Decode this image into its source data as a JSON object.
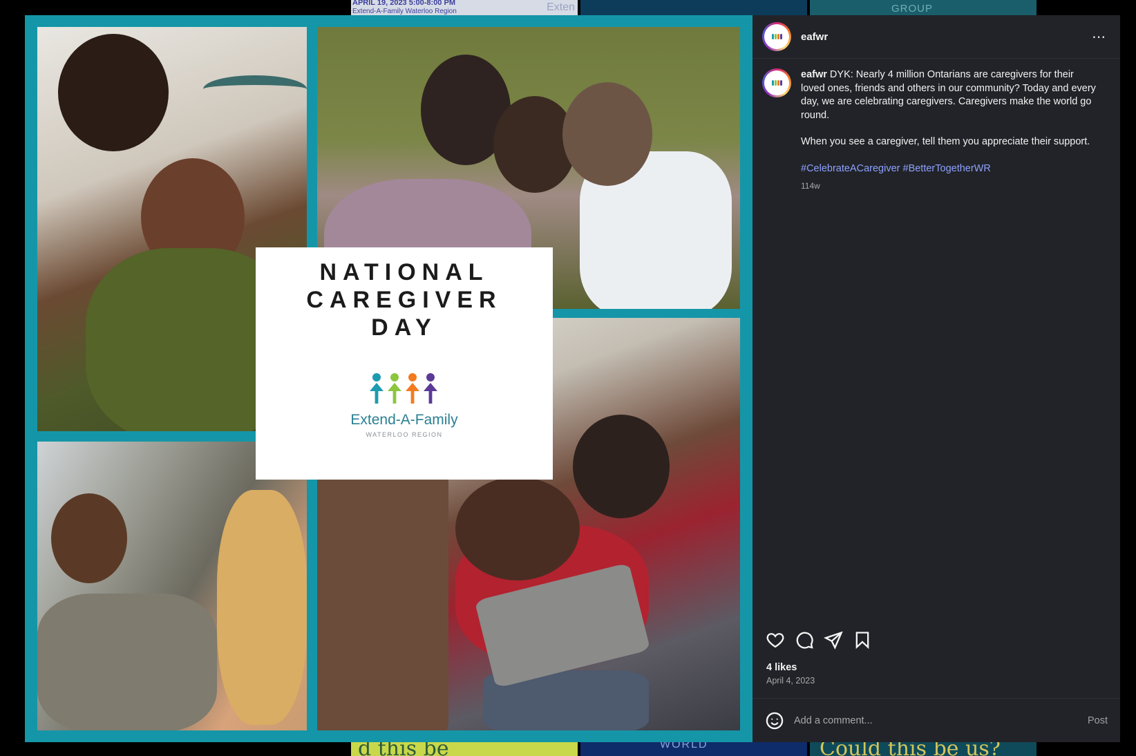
{
  "background_feed": {
    "top_left_line1": "APRIL 19, 2023    5:00-8:00 PM",
    "top_left_line2": "Extend-A-Family Waterloo Region",
    "top_left_side": "Exten",
    "top_right_word": "GROUP",
    "bottom_left_word": "d this be",
    "bottom_mid_word": "WORLD",
    "bottom_right_word": "Could this be us?"
  },
  "post_image": {
    "title_lines": [
      "NATIONAL",
      "CAREGIVER",
      "DAY"
    ],
    "logo_name": "Extend-A-Family",
    "logo_sub": "WATERLOO REGION",
    "logo_colors": [
      "#1d9bb0",
      "#8cc63f",
      "#f47a20",
      "#5b3a97"
    ],
    "frame_color": "#1596a8"
  },
  "header": {
    "username": "eafwr",
    "more_icon": "more-horizontal-icon"
  },
  "caption": {
    "username": "eafwr",
    "text": "DYK: Nearly 4 million Ontarians are caregivers for their loved ones, friends and others in our community? Today and every day, we are celebrating caregivers. Caregivers make the world go round.",
    "text2": "When you see a caregiver, tell them you appreciate their support.",
    "hashtags": [
      "#CelebrateACaregiver",
      "#BetterTogetherWR"
    ],
    "age": "114w"
  },
  "actions": {
    "like_icon": "heart-icon",
    "comment_icon": "comment-icon",
    "share_icon": "share-icon",
    "save_icon": "bookmark-icon"
  },
  "likes": "4 likes",
  "date": "April 4, 2023",
  "comment": {
    "placeholder": "Add a comment...",
    "post_label": "Post",
    "emoji_icon": "emoji-icon"
  },
  "colors": {
    "panel_bg": "#212328",
    "hashtag": "#8ea1ff",
    "muted": "#a8a8a8"
  }
}
